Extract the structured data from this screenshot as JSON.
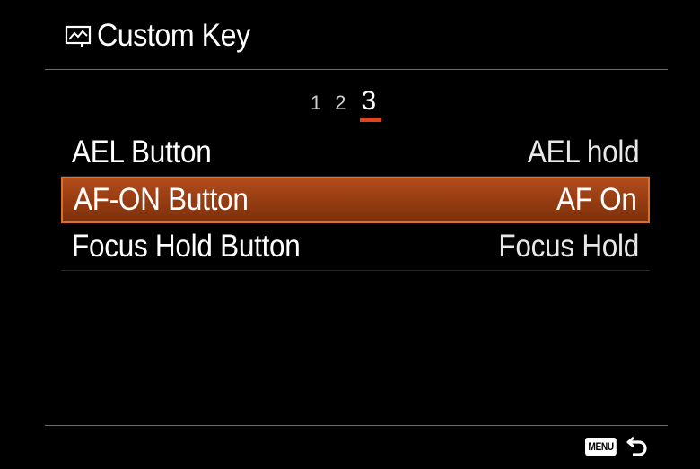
{
  "header": {
    "title": "Custom Key",
    "icon": "custom-key-icon"
  },
  "pagination": {
    "pages": [
      "1",
      "2",
      "3"
    ],
    "active_index": 2
  },
  "settings": [
    {
      "label": "AEL Button",
      "value": "AEL hold",
      "selected": false
    },
    {
      "label": "AF-ON Button",
      "value": "AF On",
      "selected": true
    },
    {
      "label": "Focus Hold Button",
      "value": "Focus Hold",
      "selected": false
    }
  ],
  "footer": {
    "menu_label": "MENU",
    "back_icon": "return-arrow-icon"
  },
  "colors": {
    "background": "#000000",
    "accent": "#e0451e",
    "selection": "#a8461a",
    "selection_border": "#d8702e"
  }
}
